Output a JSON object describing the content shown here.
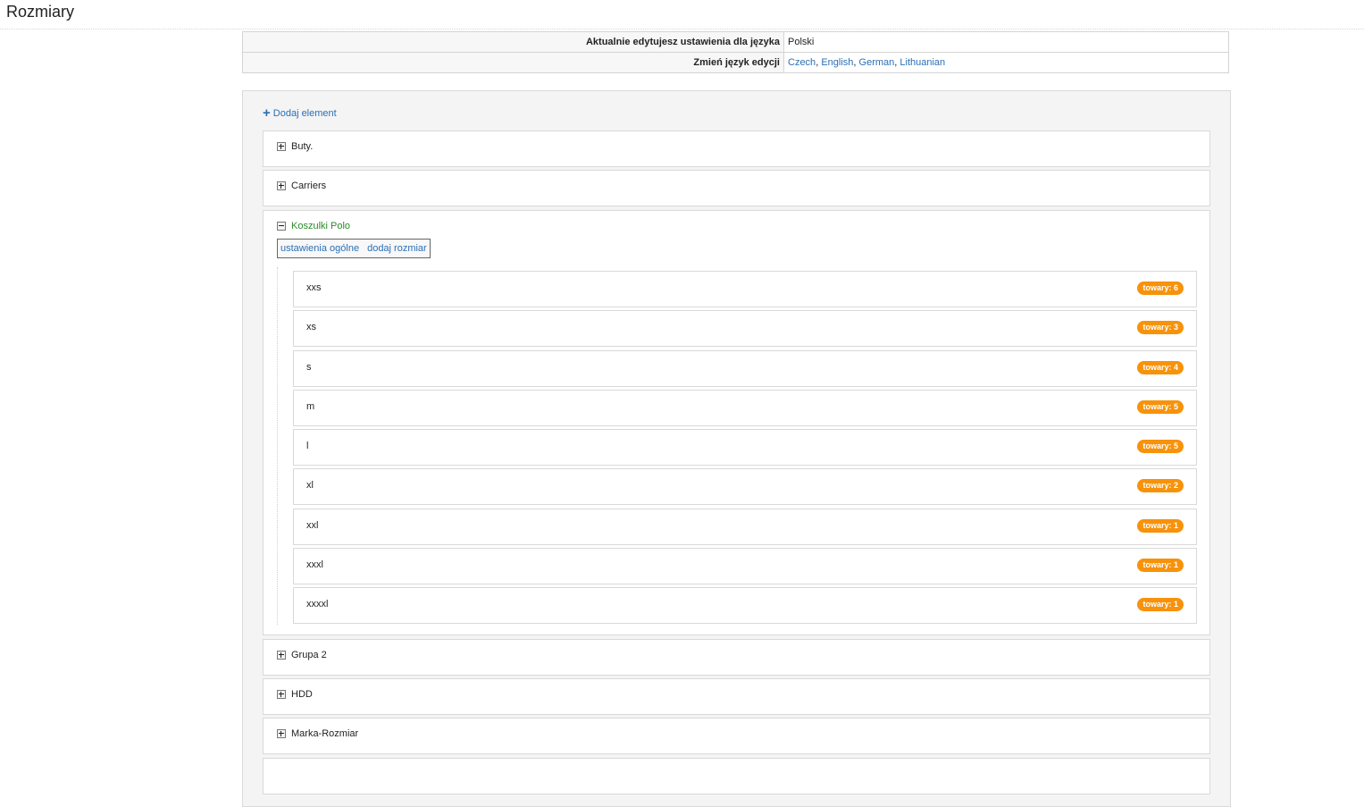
{
  "page": {
    "title": "Rozmiary"
  },
  "language": {
    "current_label": "Aktualnie edytujesz ustawienia dla języka",
    "current_value": "Polski",
    "change_label": "Zmień język edycji",
    "languages": [
      "Czech",
      "English",
      "German",
      "Lithuanian"
    ]
  },
  "toolbar": {
    "add_label": "Dodaj element"
  },
  "groups": {
    "buty": "Buty.",
    "carriers": "Carriers",
    "koszulki": "Koszulki Polo",
    "grupa2": "Grupa 2",
    "hdd": "HDD",
    "marka": "Marka-Rozmiar"
  },
  "expanded": {
    "tabs": [
      "ustawienia ogólne",
      "dodaj rozmiar"
    ],
    "sizes": [
      {
        "name": "xxs",
        "badge": "towary: 6"
      },
      {
        "name": "xs",
        "badge": "towary: 3"
      },
      {
        "name": "s",
        "badge": "towary: 4"
      },
      {
        "name": "m",
        "badge": "towary: 5"
      },
      {
        "name": "l",
        "badge": "towary: 5"
      },
      {
        "name": "xl",
        "badge": "towary: 2"
      },
      {
        "name": "xxl",
        "badge": "towary: 1"
      },
      {
        "name": "xxxl",
        "badge": "towary: 1"
      },
      {
        "name": "xxxxl",
        "badge": "towary: 1"
      }
    ]
  },
  "colors": {
    "link": "#2a6fb5",
    "badge": "#f7920b",
    "expanded_group": "#2a8a2a"
  }
}
